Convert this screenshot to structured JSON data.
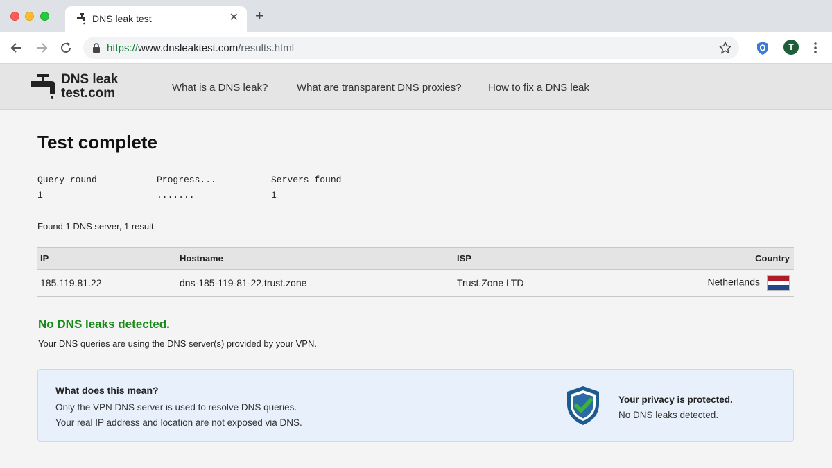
{
  "browser": {
    "tab_title": "DNS leak test",
    "url_scheme": "https://",
    "url_host": "www.dnsleaktest.com",
    "url_path": "/results.html",
    "avatar_letter": "T"
  },
  "site": {
    "logo_line1": "DNS leak",
    "logo_line2": "test.com",
    "nav": [
      "What is a DNS leak?",
      "What are transparent DNS proxies?",
      "How to fix a DNS leak"
    ]
  },
  "page": {
    "title": "Test complete",
    "stats": [
      {
        "label": "Query round",
        "value": "1"
      },
      {
        "label": "Progress...",
        "value": "......."
      },
      {
        "label": "Servers found",
        "value": "1"
      }
    ],
    "found_text": "Found 1 DNS server, 1 result."
  },
  "table": {
    "headers": [
      "IP",
      "Hostname",
      "ISP",
      "Country"
    ],
    "rows": [
      {
        "ip": "185.119.81.22",
        "hostname": "dns-185-119-81-22.trust.zone",
        "isp": "Trust.Zone LTD",
        "country": "Netherlands"
      }
    ]
  },
  "status": {
    "headline": "No DNS leaks detected.",
    "subtext": "Your DNS queries are using the DNS server(s) provided by your VPN."
  },
  "info": {
    "title": "What does this mean?",
    "line1": "Only the VPN DNS server is used to resolve DNS queries.",
    "line2": "Your real IP address and location are not exposed via DNS.",
    "protected_title": "Your privacy is protected.",
    "protected_sub": "No DNS leaks detected."
  },
  "colors": {
    "success": "#1a8a1a",
    "ip_link": "#1f7a1f",
    "info_bg": "#e8f1fb",
    "shield": "#1d5b8f",
    "check": "#3cb043",
    "flag_red": "#ae1c28",
    "flag_white": "#ffffff",
    "flag_blue": "#21468b"
  },
  "icons": [
    "faucet-icon",
    "lock-icon",
    "star-icon",
    "shield-icon",
    "check-shield-icon",
    "back-arrow-icon",
    "forward-arrow-icon",
    "reload-icon",
    "close-icon",
    "plus-icon",
    "more-vert-icon",
    "netherlands-flag-icon"
  ]
}
